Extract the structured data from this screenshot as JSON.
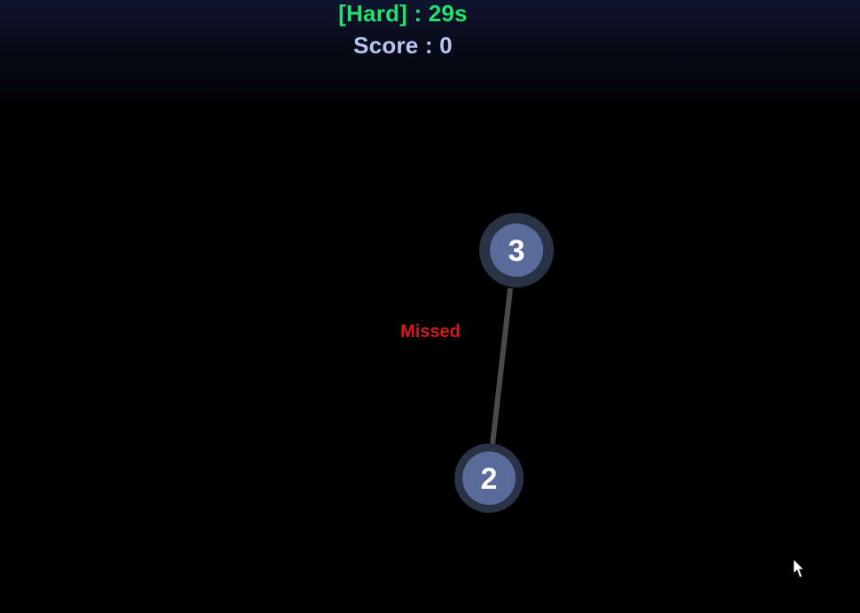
{
  "hud": {
    "timer_text": "[Hard] : 29s",
    "score_text": "Score : 0",
    "timer_color": "#22e06a",
    "score_color": "#b9c4f2"
  },
  "feedback": {
    "text": "Missed",
    "color": "#d11a1a"
  },
  "nodes": [
    {
      "label": "3"
    },
    {
      "label": "2"
    }
  ],
  "colors": {
    "node_outer": "#2a3246",
    "node_inner": "#5a6a9a",
    "node_text": "#ffffff",
    "connector": "#4a4a4a"
  },
  "cursor": {
    "icon": "mouse-pointer-icon"
  }
}
